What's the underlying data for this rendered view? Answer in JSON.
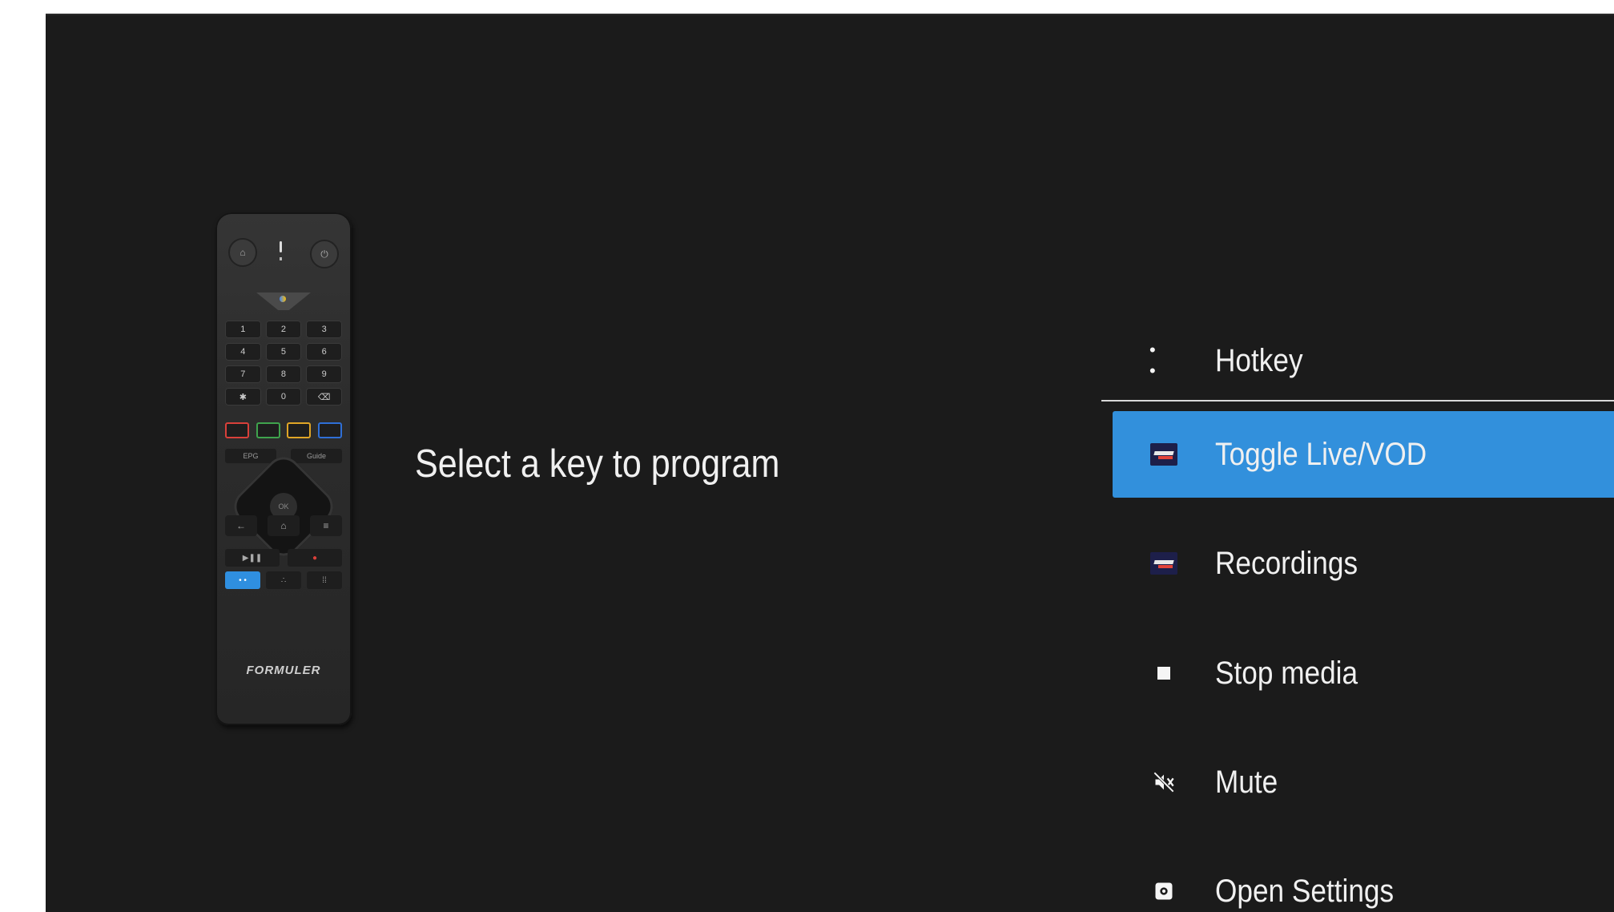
{
  "prompt": "Select a key to program",
  "remote": {
    "brand": "FORMULER",
    "keys": [
      "1",
      "2",
      "3",
      "4",
      "5",
      "6",
      "7",
      "8",
      "9",
      "✱",
      "0",
      "⌫"
    ],
    "ok": "OK",
    "nav_left": "EPG",
    "nav_right": "Guide",
    "back_icon": "←",
    "home_icon": "⌂",
    "menu_icon": "≡",
    "color_buttons": [
      "#d9403a",
      "#3fa34d",
      "#e0a526",
      "#2f6fd6"
    ]
  },
  "menu": {
    "items": [
      {
        "label": "Hotkey",
        "icon": "dots-icon"
      },
      {
        "label": "Toggle Live/VOD",
        "icon": "app-logo-icon",
        "selected": true
      },
      {
        "label": "Recordings",
        "icon": "app-logo-icon"
      },
      {
        "label": "Stop media",
        "icon": "stop-icon"
      },
      {
        "label": "Mute",
        "icon": "mute-icon"
      },
      {
        "label": "Open Settings",
        "icon": "settings-icon"
      }
    ]
  },
  "colors": {
    "background": "#1b1b1b",
    "accent": "#3290dc"
  }
}
